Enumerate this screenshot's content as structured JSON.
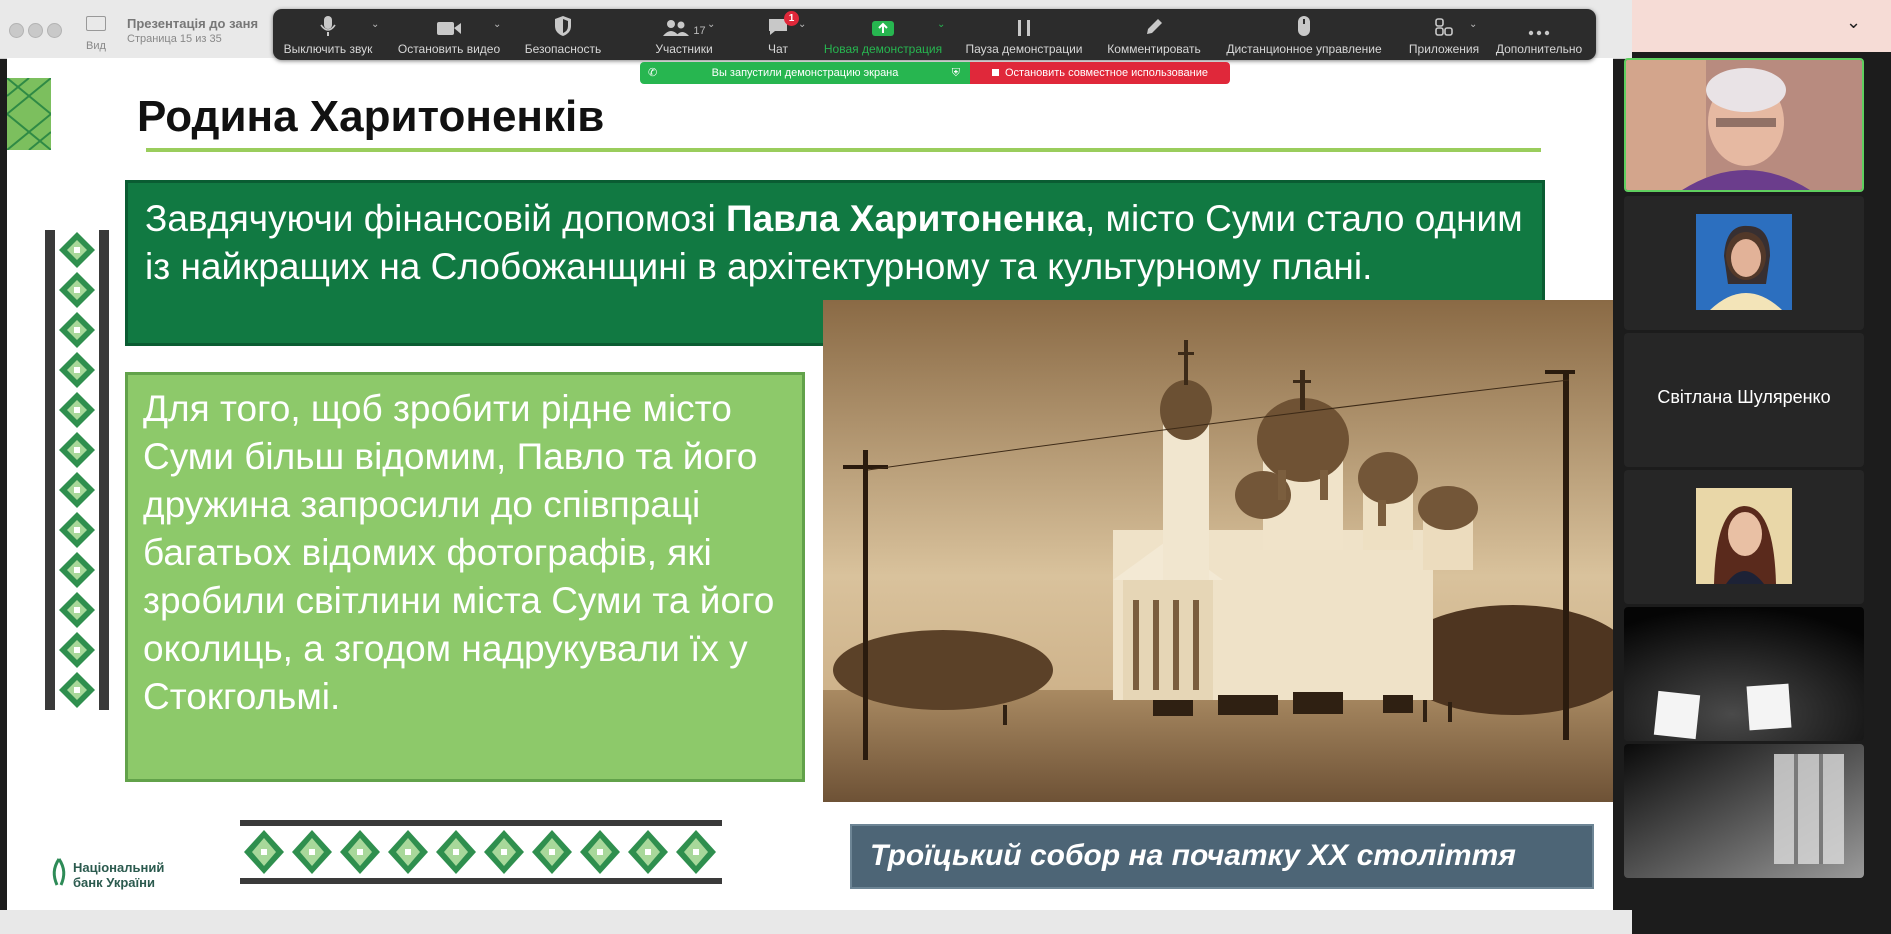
{
  "window": {
    "doc_title": "Презентація до заня",
    "doc_page": "Страница 15 из 35",
    "view_label": "Вид"
  },
  "toolbar": {
    "items": [
      {
        "label": "Выключить звук",
        "icon": "microphone-icon"
      },
      {
        "label": "Остановить видео",
        "icon": "video-camera-icon"
      },
      {
        "label": "Безопасность",
        "icon": "shield-icon"
      },
      {
        "label": "Участники",
        "icon": "participants-icon",
        "count": "17"
      },
      {
        "label": "Чат",
        "icon": "chat-icon",
        "badge": "1"
      },
      {
        "label": "Новая демонстрация",
        "icon": "share-screen-icon"
      },
      {
        "label": "Пауза демонстрации",
        "icon": "pause-icon"
      },
      {
        "label": "Комментировать",
        "icon": "pen-icon"
      },
      {
        "label": "Дистанционное управление",
        "icon": "mouse-icon"
      },
      {
        "label": "Приложения",
        "icon": "apps-icon"
      },
      {
        "label": "Дополнительно",
        "icon": "more-icon"
      }
    ],
    "active_color": "#27b650"
  },
  "share_banner": {
    "status": "Вы запустили демонстрацию экрана",
    "stop": "Остановить совместное использование"
  },
  "slide": {
    "title": "Родина Харитоненків",
    "green_text_before": "Завдячуючи фінансовій допомозі ",
    "green_text_bold": "Павла Харитоненка",
    "green_text_after": ", місто Суми стало одним із найкращих на Слобожанщині в архітектурному та культурному плані.",
    "light_text": "Для того, щоб зробити рідне місто Суми більш відомим, Павло та його дружина запросили до співпраці багатьох відомих фотографів, які зробили світлини міста Суми та його околиць, а згодом надрукували їх у Стокгольмі.",
    "caption": "Троїцький собор на початку ХХ століття",
    "bank_line1": "Національний",
    "bank_line2": "банк України",
    "colors": {
      "dark_green": "#117942",
      "light_green": "#8dc96a",
      "caption_bg": "#4d6576"
    }
  },
  "gallery": {
    "named_participant": "Світлана Шуляренко"
  }
}
